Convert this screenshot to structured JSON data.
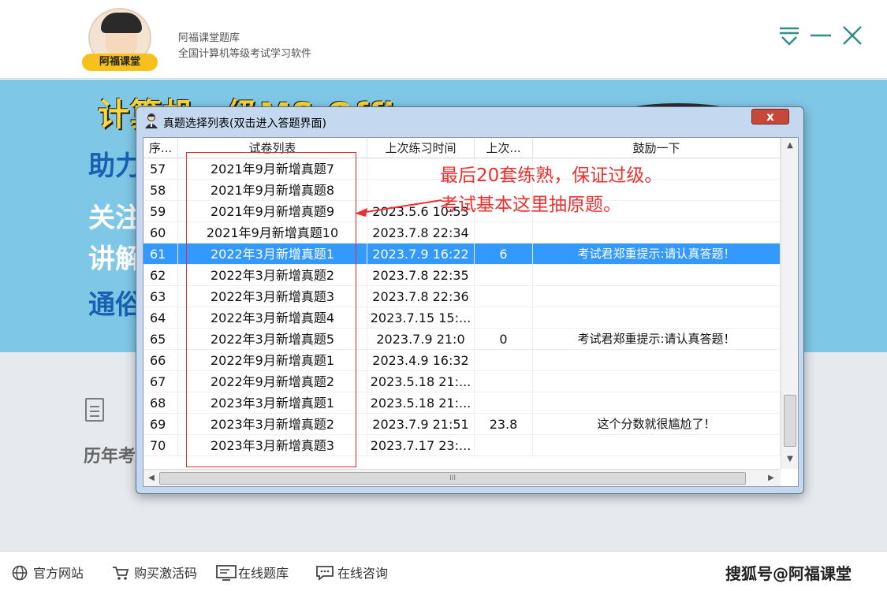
{
  "header": {
    "logo_text": "阿福课堂",
    "app_title": "阿福课堂题库",
    "app_subtitle": "全国计算机等级考试学习软件",
    "menu_icon": "menu-down-icon",
    "min_icon": "minimize-icon",
    "close_icon": "close-icon"
  },
  "banner": {
    "title": "计算机一级MS Office",
    "line1": "助力",
    "line2": "关注",
    "line3": "讲解",
    "line4": "通俗"
  },
  "lower": {
    "label": "历年考"
  },
  "footer": {
    "items": [
      {
        "label": "官方网站",
        "icon": "globe-icon"
      },
      {
        "label": "购买激活码",
        "icon": "cart-icon"
      },
      {
        "label": "在线题库",
        "icon": "monitor-icon"
      },
      {
        "label": "在线咨询",
        "icon": "chat-icon"
      }
    ],
    "watermark": "搜狐号@阿福课堂"
  },
  "dialog": {
    "title": "真题选择列表(双击进入答题界面)",
    "close_label": "x",
    "columns": {
      "seq": "序...",
      "name": "试卷列表",
      "time": "上次练习时间",
      "score": "上次...",
      "message": "鼓励一下"
    },
    "rows": [
      {
        "seq": "57",
        "name": "2021年9月新增真题7",
        "time": "",
        "score": "",
        "message": ""
      },
      {
        "seq": "58",
        "name": "2021年9月新增真题8",
        "time": "",
        "score": "",
        "message": ""
      },
      {
        "seq": "59",
        "name": "2021年9月新增真题9",
        "time": "2023.5.6 10:53",
        "score": "",
        "message": ""
      },
      {
        "seq": "60",
        "name": "2021年9月新增真题10",
        "time": "2023.7.8 22:34",
        "score": "",
        "message": ""
      },
      {
        "seq": "61",
        "name": "2022年3月新增真题1",
        "time": "2023.7.9 16:22",
        "score": "6",
        "message": "考试君郑重提示:请认真答题！",
        "selected": true
      },
      {
        "seq": "62",
        "name": "2022年3月新增真题2",
        "time": "2023.7.8 22:35",
        "score": "",
        "message": ""
      },
      {
        "seq": "63",
        "name": "2022年3月新增真题3",
        "time": "2023.7.8 22:36",
        "score": "",
        "message": ""
      },
      {
        "seq": "64",
        "name": "2022年3月新增真题4",
        "time": "2023.7.15 15:...",
        "score": "",
        "message": ""
      },
      {
        "seq": "65",
        "name": "2022年3月新增真题5",
        "time": "2023.7.9 21:0",
        "score": "0",
        "message": "考试君郑重提示:请认真答题！"
      },
      {
        "seq": "66",
        "name": "2022年9月新增真题1",
        "time": "2023.4.9 16:32",
        "score": "",
        "message": ""
      },
      {
        "seq": "67",
        "name": "2022年9月新增真题2",
        "time": "2023.5.18 21:...",
        "score": "",
        "message": ""
      },
      {
        "seq": "68",
        "name": "2023年3月新增真题1",
        "time": "2023.5.18 21:...",
        "score": "",
        "message": ""
      },
      {
        "seq": "69",
        "name": "2023年3月新增真题2",
        "time": "2023.7.9 21:51",
        "score": "23.8",
        "message": "这个分数就很尴尬了！"
      },
      {
        "seq": "70",
        "name": "2023年3月新增真题3",
        "time": "2023.7.17 23:...",
        "score": "",
        "message": ""
      }
    ],
    "hscroll_grip": "III",
    "selected_color": "#3399ff"
  },
  "annotation": {
    "line1": "最后20套练熟，保证过级。",
    "line2": "考试基本这里抽原题。",
    "color": "#ee2f2f"
  }
}
